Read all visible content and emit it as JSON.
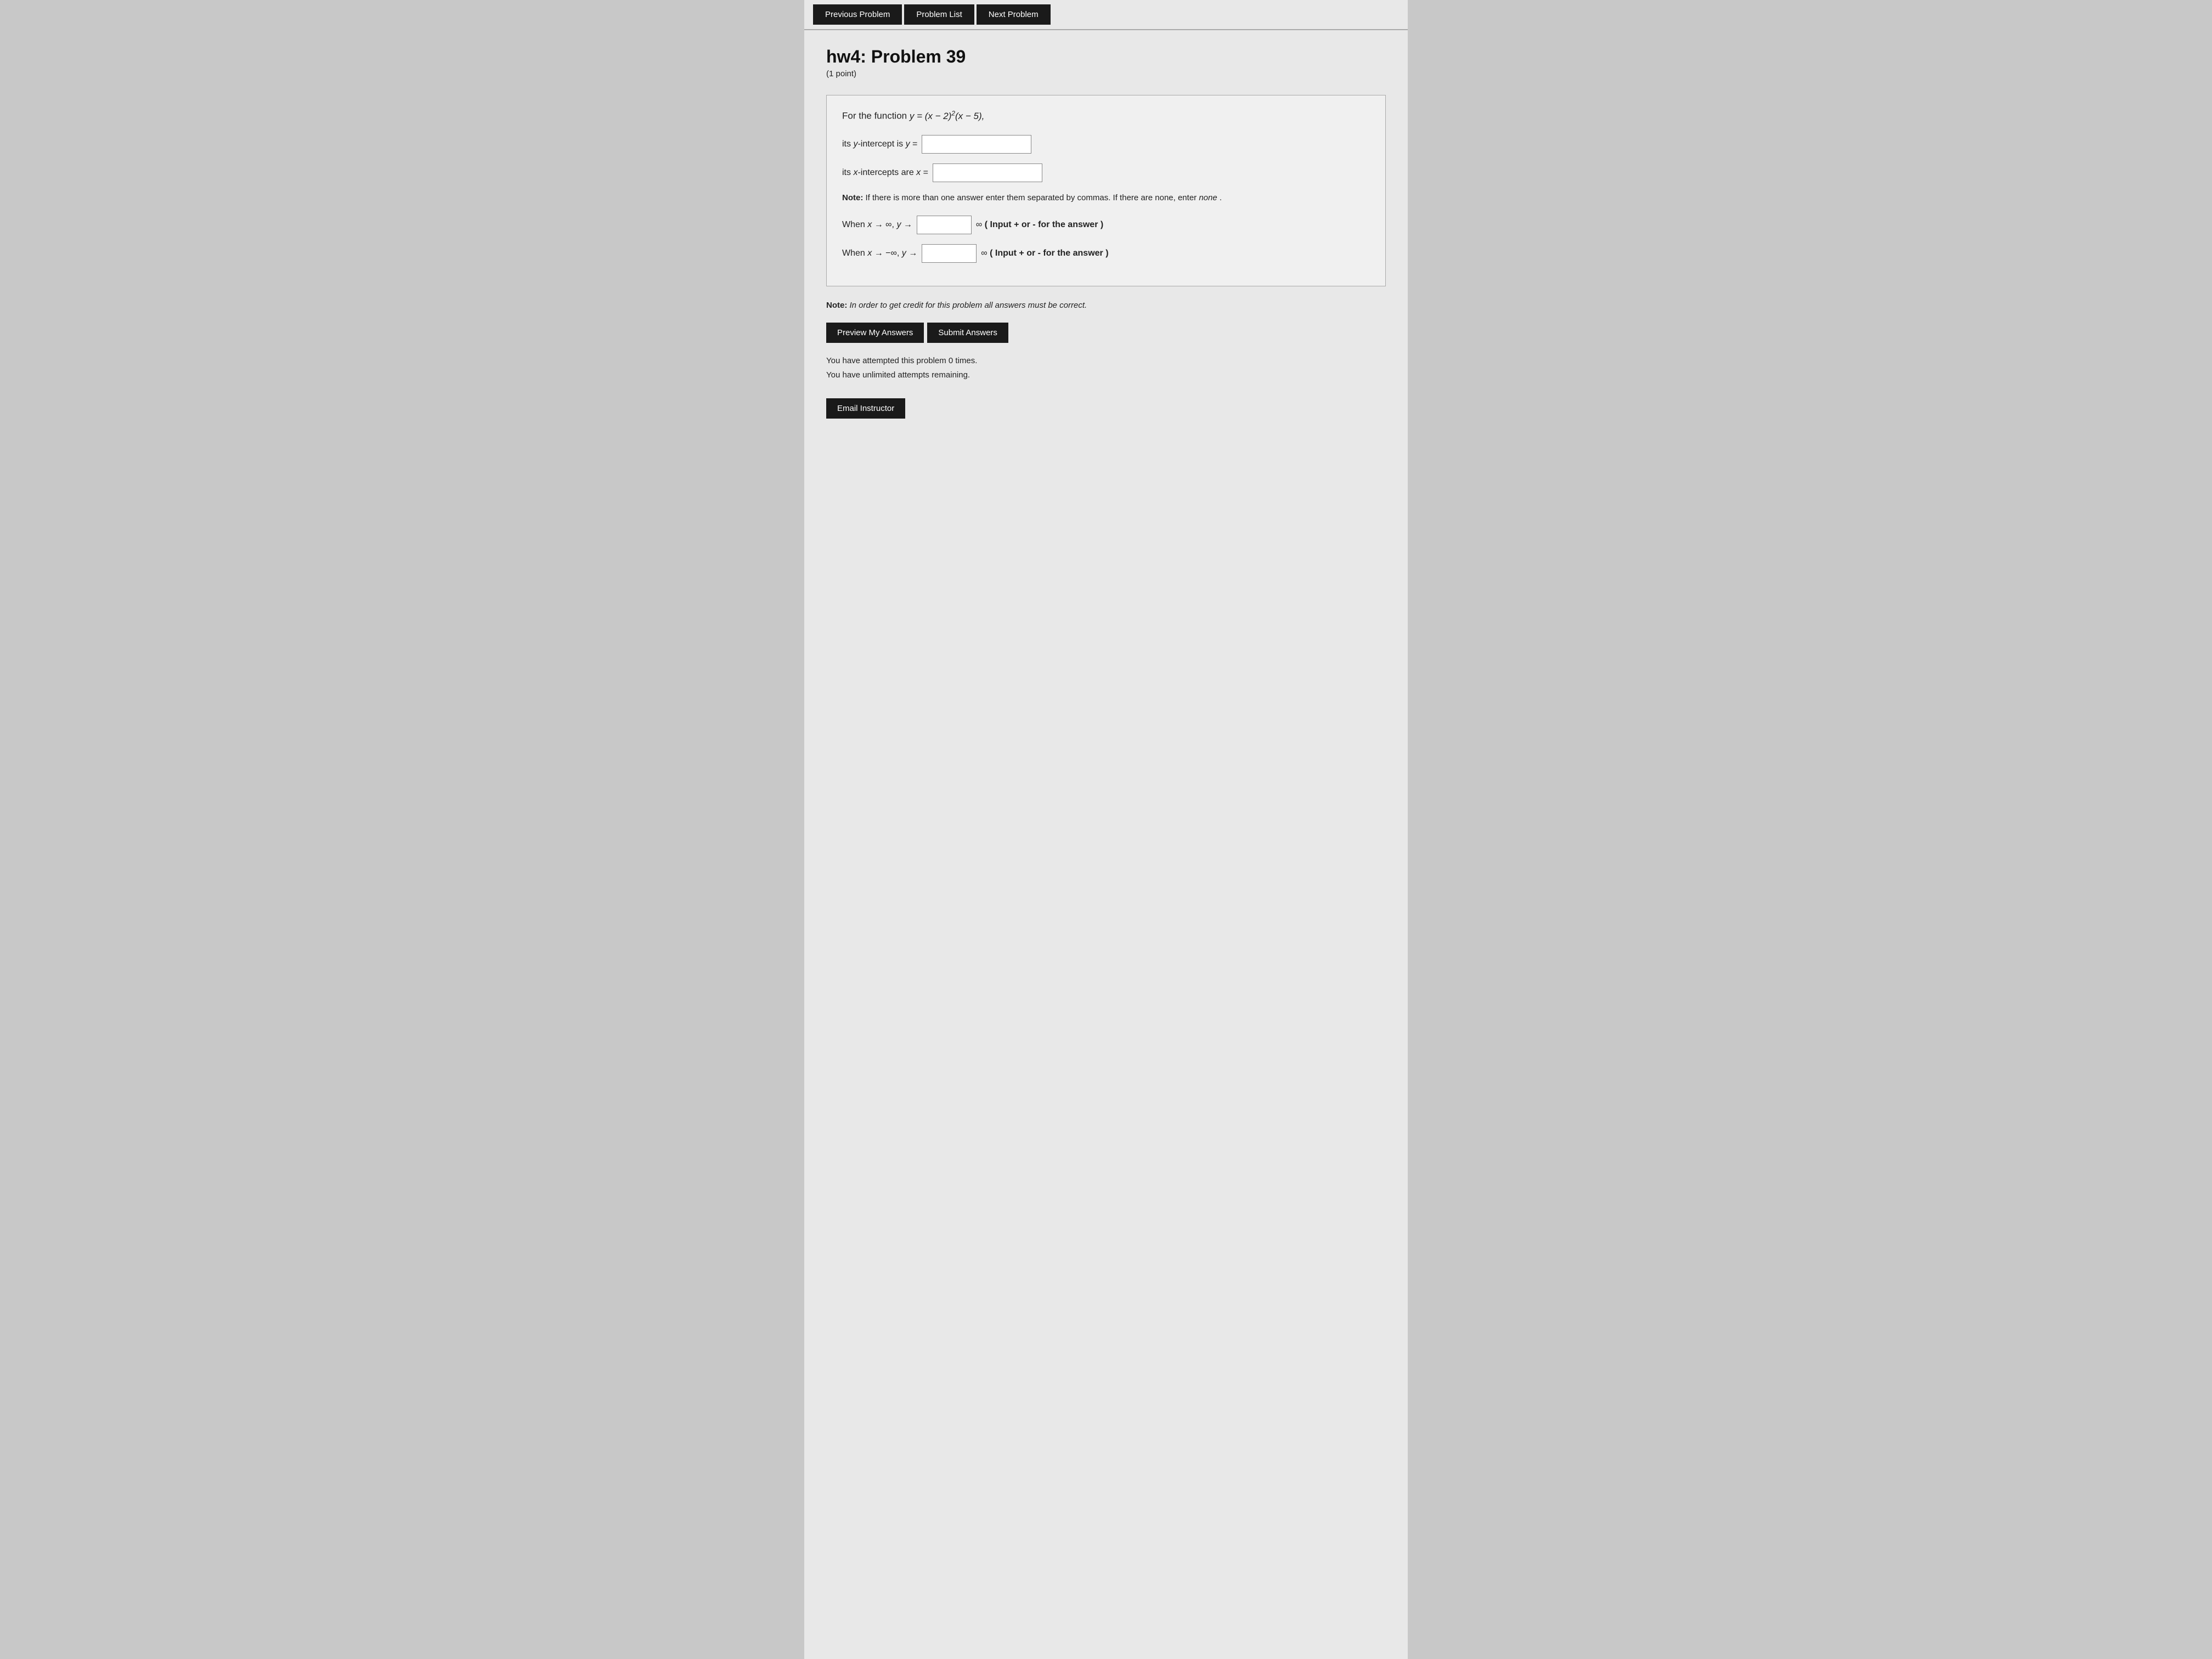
{
  "nav": {
    "previous_label": "Previous Problem",
    "list_label": "Problem List",
    "next_label": "Next Problem"
  },
  "problem": {
    "title": "hw4: Problem 39",
    "points": "(1 point)",
    "function_text": "For the function ",
    "function_math": "y = (x − 2)²(x − 5),",
    "y_intercept_label": "its y-intercept is y =",
    "x_intercept_label": "its x-intercepts are x =",
    "note_label": "Note:",
    "note_text": " If there is more than one answer enter them separated by commas. If there are none, enter ",
    "note_italic": "none",
    "note_end": " .",
    "when_pos_inf_label": "When x → ∞, y →",
    "when_pos_inf_suffix": "∞ ( Input + or - for the answer )",
    "when_neg_inf_label": "When x → −∞, y →",
    "when_neg_inf_suffix": "∞ ( Input + or - for the answer )",
    "bottom_note_label": "Note:",
    "bottom_note_text": " In order to get credit for this problem all answers must be correct.",
    "preview_button": "Preview My Answers",
    "submit_button": "Submit Answers",
    "attempts_line1": "You have attempted this problem 0 times.",
    "attempts_line2": "You have unlimited attempts remaining.",
    "email_button": "Email Instructor"
  }
}
